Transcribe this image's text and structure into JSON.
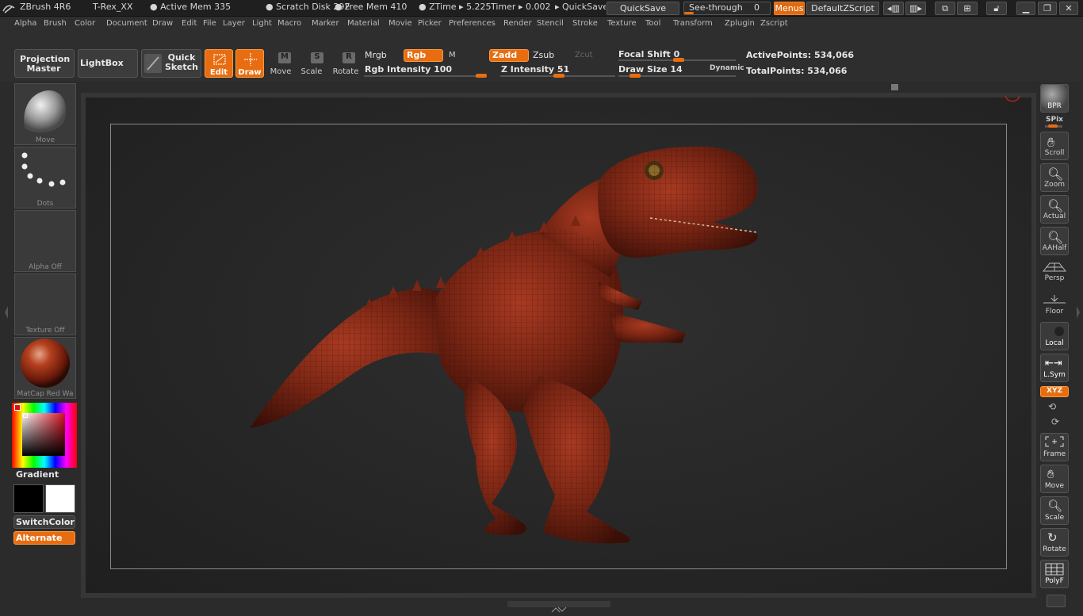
{
  "titlebar": {
    "app": "ZBrush 4R6",
    "document": "T-Rex_XX",
    "active_mem": "● Active Mem 335",
    "scratch_disk": "● Scratch Disk 292",
    "free_mem": "● Free Mem 410",
    "ztime": "● ZTime ▸ 5.225",
    "timer": "Timer ▸ 0.002",
    "quicksave_text": "▸ QuickSave",
    "quicksave_btn": "QuickSave",
    "seethrough": "See-through",
    "seethrough_value": "0",
    "menus_btn": "Menus",
    "script_btn": "DefaultZScript"
  },
  "menu": [
    "Alpha",
    "Brush",
    "Color",
    "Document",
    "Draw",
    "Edit",
    "File",
    "Layer",
    "Light",
    "Macro",
    "Marker",
    "Material",
    "Movie",
    "Picker",
    "Preferences",
    "Render",
    "Stencil",
    "Stroke",
    "Texture",
    "Tool",
    "Transform",
    "Zplugin",
    "Zscript"
  ],
  "shelf": {
    "projection_master": "Projection Master",
    "lightbox": "LightBox",
    "quick_sketch": "Quick Sketch",
    "edit": "Edit",
    "draw": "Draw",
    "move": "Move",
    "scale": "Scale",
    "rotate": "Rotate",
    "mrgb": "Mrgb",
    "rgb": "Rgb",
    "m": "M",
    "zadd": "Zadd",
    "zsub": "Zsub",
    "zcut": "Zcut",
    "rgb_intensity": "Rgb Intensity 100",
    "z_intensity": "Z Intensity 51",
    "focal_shift": "Focal Shift 0",
    "draw_size": "Draw Size 14",
    "dynamic": "Dynamic",
    "active_points": "ActivePoints: 534,066",
    "total_points": "TotalPoints: 534,066"
  },
  "rgb_intensity": 100,
  "z_intensity": 51,
  "left": {
    "brush_label": "Move",
    "stroke_label": "Dots",
    "alpha_label": "Alpha Off",
    "texture_label": "Texture Off",
    "material_label": "MatCap Red Wa",
    "gradient": "Gradient",
    "switchcolor": "SwitchColor",
    "alternate": "Alternate"
  },
  "right": {
    "bpr": "BPR",
    "spix": "SPix",
    "scroll": "Scroll",
    "zoom": "Zoom",
    "actual": "Actual",
    "aahalf": "AAHalf",
    "persp": "Persp",
    "floor": "Floor",
    "local": "Local",
    "lsym": "L.Sym",
    "xyz": "XYZ",
    "frame": "Frame",
    "move": "Move",
    "scale": "Scale",
    "rotate": "Rotate",
    "polyf": "PolyF"
  },
  "colors": {
    "accent": "#e86d10",
    "material": "#9a2a14",
    "model": "#6e2012"
  }
}
